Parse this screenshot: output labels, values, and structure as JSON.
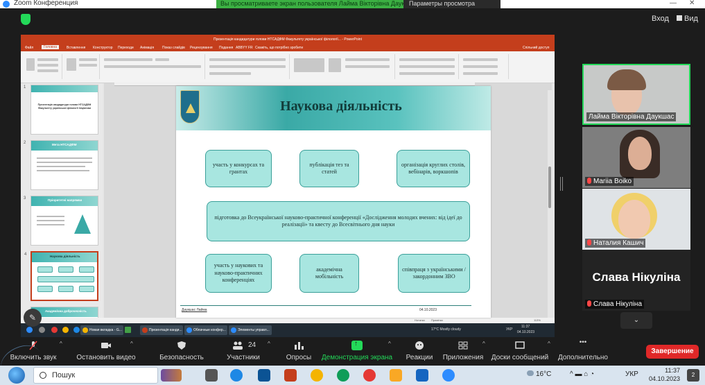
{
  "zoom_window": {
    "title": "Zoom Конференция",
    "banner_left": "Вы просматриваете экран пользователя Лайма Вікторівна Даукшас",
    "banner_right": "Параметры просмотра",
    "top_right": {
      "view_button": "Вход",
      "layout_button": "Вид"
    }
  },
  "powerpoint": {
    "title_bar": "Презентація кандидатури голови НТСАДФМ Факультету української філології... - PowerPoint",
    "tabs": [
      "Файл",
      "Головна",
      "Вставлення",
      "Конструктор",
      "Переходи",
      "Анімація",
      "Показ слайдів",
      "Рецензування",
      "Подання",
      "ABBYY FR",
      "Скажіть, що потрібно зробити"
    ],
    "share_label": "Спільний доступ",
    "thumbnails": [
      {
        "num": "1",
        "caption": "Презентація кандидатури голови НТСАДФМ Факультету української філології Ініціативи"
      },
      {
        "num": "2",
        "caption": "Мета НТСАДФМ"
      },
      {
        "num": "3",
        "caption": "Пріоритетні напрямки"
      },
      {
        "num": "4",
        "caption": "Наукова діяльність"
      },
      {
        "num": "5",
        "caption": "Академічна доброчесність"
      }
    ],
    "slide": {
      "title": "Наукова діяльність",
      "boxes": {
        "b1": "участь у конкурсах та грантах",
        "b2": "публікація тез та статей",
        "b3": "організація круглих столів, вебінарів, воркшопів",
        "b4": "підготовка до Всеукраїнської науково-практичної конференції «Дослідження молодих вчених: від ідеї до реалізації» та квесту до Всесвітнього дня науки",
        "b5": "участь у наукових та науково-практичних конференціях",
        "b6": "академічна мобільність",
        "b7": "співпраця з українськими / закордонним ЗВО"
      },
      "footer_author": "Даукшас Лайма",
      "footer_date": "04.10.2023"
    },
    "status_bar": {
      "notes": "Нотатки",
      "comments": "Примітки",
      "zoom": "113%"
    }
  },
  "inner_taskbar": {
    "apps": [
      "Новая вкладка - G...",
      "Презентація канди...",
      "Облачные конфер...",
      "Элементы управл..."
    ],
    "weather": "17°C Mostly cloudy",
    "lang": "УКР",
    "time": "11:37",
    "date": "04.10.2023"
  },
  "participants": [
    {
      "name": "Лайма Вікторівна Даукшас",
      "active": true
    },
    {
      "name": "Mariia Boiko",
      "active": false
    },
    {
      "name": "Наталия Кашич",
      "active": false
    },
    {
      "name": "Слава Нікуліна",
      "display": "Слава Нікуліна",
      "active": false
    }
  ],
  "controls": {
    "mute": "Включить звук",
    "video": "Остановить видео",
    "security": "Безопасность",
    "participants": "Участники",
    "participants_count": "24",
    "polls": "Опросы",
    "share": "Демонстрация экрана",
    "reactions": "Реакции",
    "apps": "Приложения",
    "whiteboards": "Доски сообщений",
    "more": "Дополнительно",
    "end": "Завершение"
  },
  "win_taskbar": {
    "search_placeholder": "Пошук",
    "temp": "16°C",
    "lang": "УКР",
    "time": "11:37",
    "date": "04.10.2023",
    "notifications": "2"
  },
  "colors": {
    "accent_green": "#23d959",
    "end_red": "#e02828",
    "ppt_red": "#c43e1c",
    "teal": "#3aa9a6"
  }
}
